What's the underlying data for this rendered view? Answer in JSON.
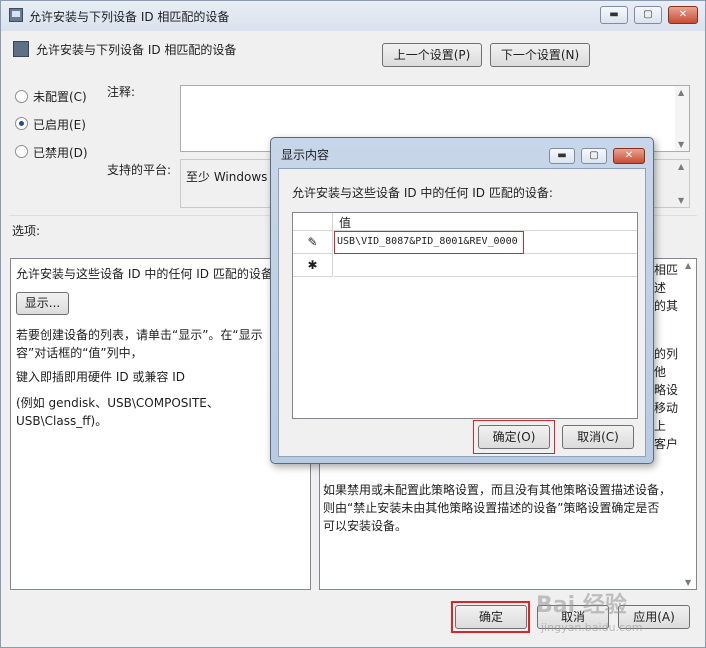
{
  "window": {
    "title": "允许安装与下列设备 ID 相匹配的设备",
    "heading": "允许安装与下列设备 ID 相匹配的设备",
    "prev_setting": "上一个设置(P)",
    "next_setting": "下一个设置(N)",
    "minimize": "▬",
    "maximize": "▢",
    "close": "✕"
  },
  "state": {
    "options": [
      {
        "label": "未配置(C)",
        "selected": false
      },
      {
        "label": "已启用(E)",
        "selected": true
      },
      {
        "label": "已禁用(D)",
        "selected": false
      }
    ],
    "comment_label": "注释:",
    "platform_label": "支持的平台:",
    "platform_value": "至少 Windows V"
  },
  "options_section": {
    "label": "选项:",
    "line1": "允许安装与这些设备 ID 中的任何 ID 匹配的设备",
    "show_button": "显示...",
    "help1a": "若要创建设备的列表，请单击“显示”。在“显示",
    "help1b": "容”对话框的“值”列中，",
    "help2": "键入即插即用硬件 ID 或兼容 ID",
    "help3a": "(例如 gendisk、USB\\COMPOSITE、",
    "help3b": "USB\\Class_ff)。"
  },
  "help_section": {
    "right_fragments": [
      "相匹",
      "述",
      "的其",
      "的列",
      "他",
      "略设",
      "移动",
      "上",
      "客户"
    ],
    "para1": "如果禁用或未配置此策略设置，而且没有其他策略设置描述设备，",
    "para2": "则由“禁止安装未由其他策略设置描述的设备”策略设置确定是否",
    "para3": "可以安装设备。"
  },
  "footer": {
    "ok": "确定",
    "cancel": "取消",
    "apply": "应用(A)"
  },
  "dialog": {
    "title": "显示内容",
    "prompt": "允许安装与这些设备 ID 中的任何 ID 匹配的设备:",
    "column_header": "值",
    "rows": [
      {
        "marker": "✎",
        "value": "USB\\VID_8087&PID_8001&REV_0000"
      },
      {
        "marker": "✱",
        "value": ""
      }
    ],
    "ok": "确定(O)",
    "cancel": "取消(C)",
    "minimize": "▬",
    "maximize": "▢",
    "close": "✕"
  },
  "watermark": "Bai 经验",
  "watermark_sub": "jingyan.baidu.com",
  "colors": {
    "highlight": "#d9262c",
    "accent": "#1d4f99"
  }
}
